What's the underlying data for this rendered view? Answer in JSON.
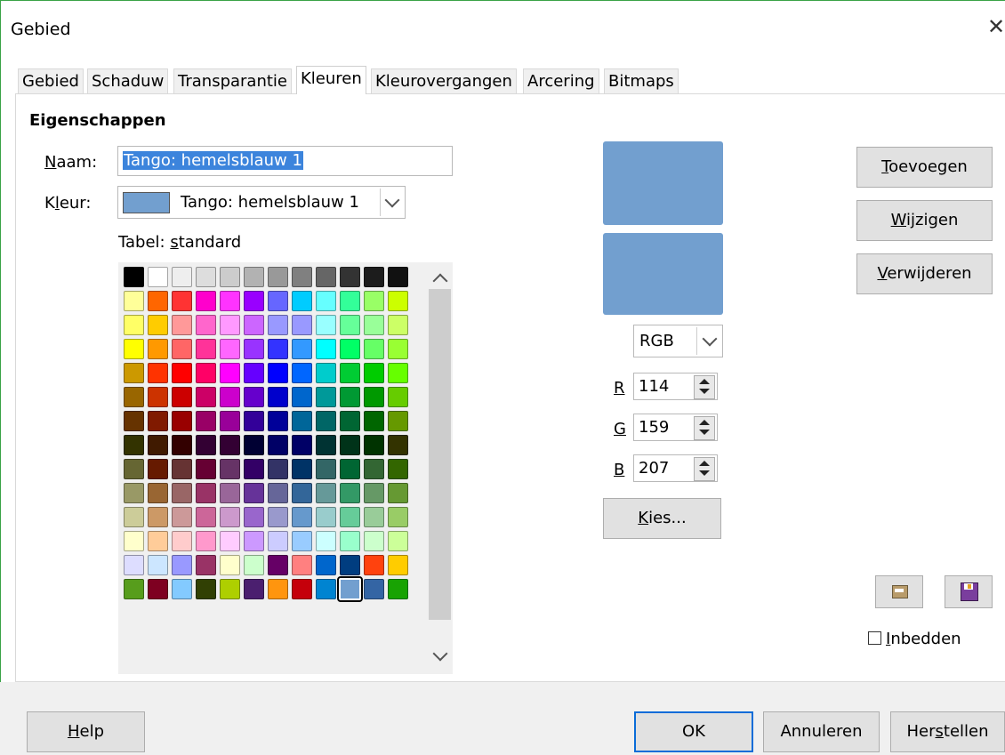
{
  "window": {
    "title": "Gebied"
  },
  "tabs": [
    "Gebied",
    "Schaduw",
    "Transparantie",
    "Kleuren",
    "Kleurovergangen",
    "Arcering",
    "Bitmaps"
  ],
  "active_tab": "Kleuren",
  "section_title": "Eigenschappen",
  "name_field": {
    "label": "Naam:",
    "value": "Tango: hemelsblauw 1"
  },
  "color_field": {
    "label": "Kleur:",
    "value": "Tango: hemelsblauw 1",
    "swatch": "#729fcf"
  },
  "palette_label": "Tabel: standard",
  "palette": [
    [
      "#000000",
      "#ffffff",
      "#eeeeee",
      "#dddddd",
      "#cccccc",
      "#b2b2b2",
      "#999999",
      "#808080",
      "#666666",
      "#333333",
      "#1c1c1c",
      "#111111"
    ],
    [
      "#ffff99",
      "#ff6600",
      "#ff3333",
      "#ff00cc",
      "#ff33ff",
      "#9900ff",
      "#6666ff",
      "#00ccff",
      "#66ffff",
      "#33ff99",
      "#99ff66",
      "#ccff00"
    ],
    [
      "#ffff66",
      "#ffcc00",
      "#ff9999",
      "#ff66cc",
      "#ff99ff",
      "#cc66ff",
      "#9999ff",
      "#9999ff",
      "#99ffff",
      "#66ff99",
      "#99ff99",
      "#ccff66"
    ],
    [
      "#ffff00",
      "#ff9900",
      "#ff6666",
      "#ff3399",
      "#ff66ff",
      "#9933ff",
      "#3333ff",
      "#3399ff",
      "#00ffff",
      "#00ff66",
      "#66ff66",
      "#99ff33"
    ],
    [
      "#cc9900",
      "#ff3300",
      "#ff0000",
      "#ff0066",
      "#ff00ff",
      "#6600ff",
      "#0000ff",
      "#0066ff",
      "#00cccc",
      "#00cc33",
      "#00cc00",
      "#66ff00"
    ],
    [
      "#996600",
      "#cc3300",
      "#cc0000",
      "#cc0066",
      "#cc00cc",
      "#6600cc",
      "#0000cc",
      "#0066cc",
      "#009999",
      "#009933",
      "#009900",
      "#66cc00"
    ],
    [
      "#663300",
      "#801a00",
      "#990000",
      "#990066",
      "#990099",
      "#330099",
      "#000099",
      "#006699",
      "#006666",
      "#006633",
      "#006600",
      "#669900"
    ],
    [
      "#333300",
      "#401a00",
      "#330000",
      "#330033",
      "#330033",
      "#000033",
      "#000066",
      "#000066",
      "#003333",
      "#003319",
      "#003300",
      "#333300"
    ],
    [
      "#666633",
      "#661a00",
      "#663333",
      "#660033",
      "#663366",
      "#330066",
      "#333366",
      "#003366",
      "#336666",
      "#006633",
      "#336633",
      "#336600"
    ],
    [
      "#999966",
      "#996633",
      "#996666",
      "#993366",
      "#996699",
      "#663399",
      "#666699",
      "#336699",
      "#669999",
      "#339966",
      "#669966",
      "#669933"
    ],
    [
      "#cccc99",
      "#cc9966",
      "#cc9999",
      "#cc6699",
      "#cc99cc",
      "#9966cc",
      "#9999cc",
      "#6699cc",
      "#99cccc",
      "#66cc99",
      "#99cc99",
      "#99cc66"
    ],
    [
      "#ffffcc",
      "#ffcc99",
      "#ffcccc",
      "#ff99cc",
      "#ffccff",
      "#cc99ff",
      "#ccccff",
      "#99ccff",
      "#ccffff",
      "#99ffcc",
      "#ccffcc",
      "#ccff99"
    ],
    [
      "#ddddff",
      "#cce6ff",
      "#9999ff",
      "#993366",
      "#ffffcc",
      "#ccffcc",
      "#660066",
      "#ff8080",
      "#0066cc",
      "#003d80",
      "#ff420e",
      "#ffcc00"
    ],
    [
      "#579d1c",
      "#7e0021",
      "#83caff",
      "#314004",
      "#aecf00",
      "#4b1f6f",
      "#ff950e",
      "#c5000b",
      "#0084d1",
      "#729fcf",
      "#3465a4",
      "#18a303"
    ]
  ],
  "selected_swatch": {
    "row": 13,
    "col": 9
  },
  "preview": {
    "old_color": "#729fcf",
    "new_color": "#729fcf"
  },
  "color_mode": "RGB",
  "rgb": {
    "r_label": "R",
    "g_label": "G",
    "b_label": "B",
    "r": "114",
    "g": "159",
    "b": "207"
  },
  "buttons": {
    "pick": "Kies...",
    "add": "Toevoegen",
    "modify": "Wijzigen",
    "delete": "Verwijderen",
    "embed": "Inbedden",
    "help": "Help",
    "ok": "OK",
    "cancel": "Annuleren",
    "reset": "Herstellen"
  },
  "icons": [
    "close-icon",
    "load-palette-icon",
    "save-palette-icon",
    "scroll-up-icon",
    "scroll-down-icon",
    "chevron-down-icon"
  ]
}
